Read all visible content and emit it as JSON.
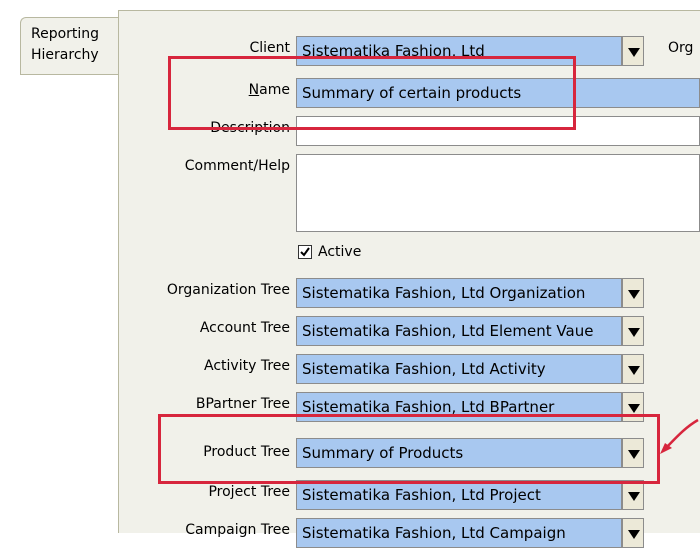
{
  "tab": {
    "line1": "Reporting",
    "line2": "Hierarchy"
  },
  "client": {
    "label": "Client",
    "value": "Sistematika Fashion, Ltd"
  },
  "org_label": "Org",
  "name": {
    "label": "Name",
    "mnemonic": "N",
    "rest": "ame",
    "value": "Summary of certain products"
  },
  "description": {
    "label": "Description",
    "value": ""
  },
  "comment": {
    "label": "Comment/Help",
    "value": ""
  },
  "active": {
    "label": "Active",
    "checked": true
  },
  "trees": [
    {
      "label": "Organization Tree",
      "value": "Sistematika Fashion, Ltd Organization"
    },
    {
      "label": "Account Tree",
      "value": "Sistematika Fashion, Ltd Element Vaue"
    },
    {
      "label": "Activity Tree",
      "value": "Sistematika Fashion, Ltd Activity"
    },
    {
      "label": "BPartner Tree",
      "value": "Sistematika Fashion, Ltd BPartner"
    },
    {
      "label": "Product Tree",
      "value": "Summary of Products"
    },
    {
      "label": "Project Tree",
      "value": "Sistematika Fashion, Ltd Project"
    },
    {
      "label": "Campaign Tree",
      "value": "Sistematika Fashion, Ltd Campaign"
    }
  ],
  "colors": {
    "field": "#a8c8f0",
    "panel": "#f1f1ea",
    "highlight": "#d7263d"
  },
  "icons": {
    "dropdown": "chevron-down-icon",
    "checkmark": "checkmark-icon",
    "arrow": "arrow-icon"
  }
}
